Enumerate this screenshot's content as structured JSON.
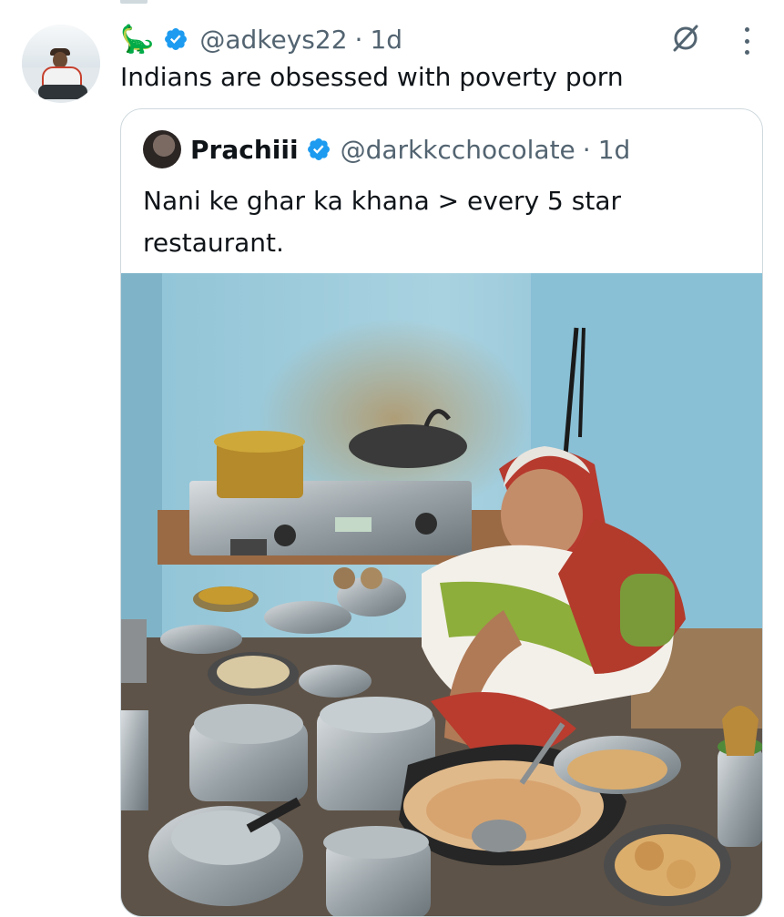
{
  "tweet": {
    "emoji": "🦕",
    "handle": "@adkeys22",
    "separator": "·",
    "time": "1d",
    "text": "Indians are obsessed with poverty porn"
  },
  "quoted_tweet": {
    "name": "Prachiii",
    "handle": "@darkkcchocolate",
    "separator": "·",
    "time": "1d",
    "text": "Nani ke ghar ka khana > every 5 star restaurant."
  },
  "icons": {
    "verified": "verified-badge-icon",
    "grok": "grok-icon",
    "more": "more-options-icon"
  },
  "colors": {
    "verified_blue": "#1d9bf0",
    "muted_text": "#536471",
    "border": "#cfd9de"
  }
}
